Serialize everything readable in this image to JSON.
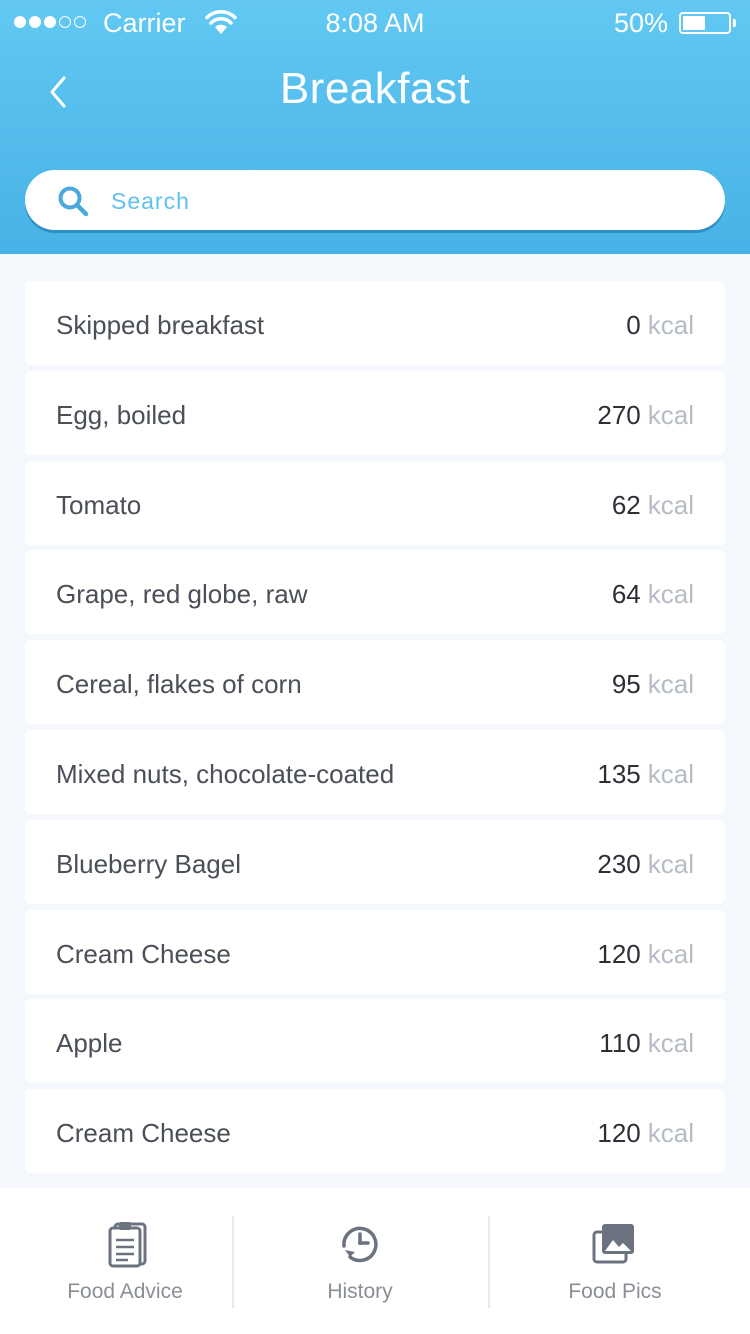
{
  "status_bar": {
    "carrier": "Carrier",
    "time": "8:08 AM",
    "battery": "50%",
    "battery_level": 0.5
  },
  "header": {
    "title": "Breakfast",
    "back_icon": "chevron-left-icon"
  },
  "search": {
    "placeholder": "Search",
    "value": "",
    "icon": "search-icon"
  },
  "foods": [
    {
      "name": "Skipped breakfast",
      "kcal": "0",
      "unit": "kcal"
    },
    {
      "name": "Egg, boiled",
      "kcal": "270",
      "unit": "kcal"
    },
    {
      "name": "Tomato",
      "kcal": "62",
      "unit": "kcal"
    },
    {
      "name": "Grape, red globe, raw",
      "kcal": "64",
      "unit": "kcal"
    },
    {
      "name": "Cereal, flakes of corn",
      "kcal": "95",
      "unit": "kcal"
    },
    {
      "name": "Mixed nuts, chocolate-coated",
      "kcal": "135",
      "unit": "kcal"
    },
    {
      "name": "Blueberry Bagel",
      "kcal": "230",
      "unit": "kcal"
    },
    {
      "name": "Cream Cheese",
      "kcal": "120",
      "unit": "kcal"
    },
    {
      "name": "Apple",
      "kcal": "110",
      "unit": "kcal"
    },
    {
      "name": "Cream Cheese",
      "kcal": "120",
      "unit": "kcal"
    }
  ],
  "tabs": [
    {
      "label": "Food Advice",
      "icon": "clipboard-icon"
    },
    {
      "label": "History",
      "icon": "history-icon"
    },
    {
      "label": "Food Pics",
      "icon": "photos-icon"
    }
  ],
  "colors": {
    "header_gradient_top": "#62c8f3",
    "header_gradient_bottom": "#47b2e5",
    "accent": "#4aa8dc",
    "background": "#f4f7fb"
  }
}
